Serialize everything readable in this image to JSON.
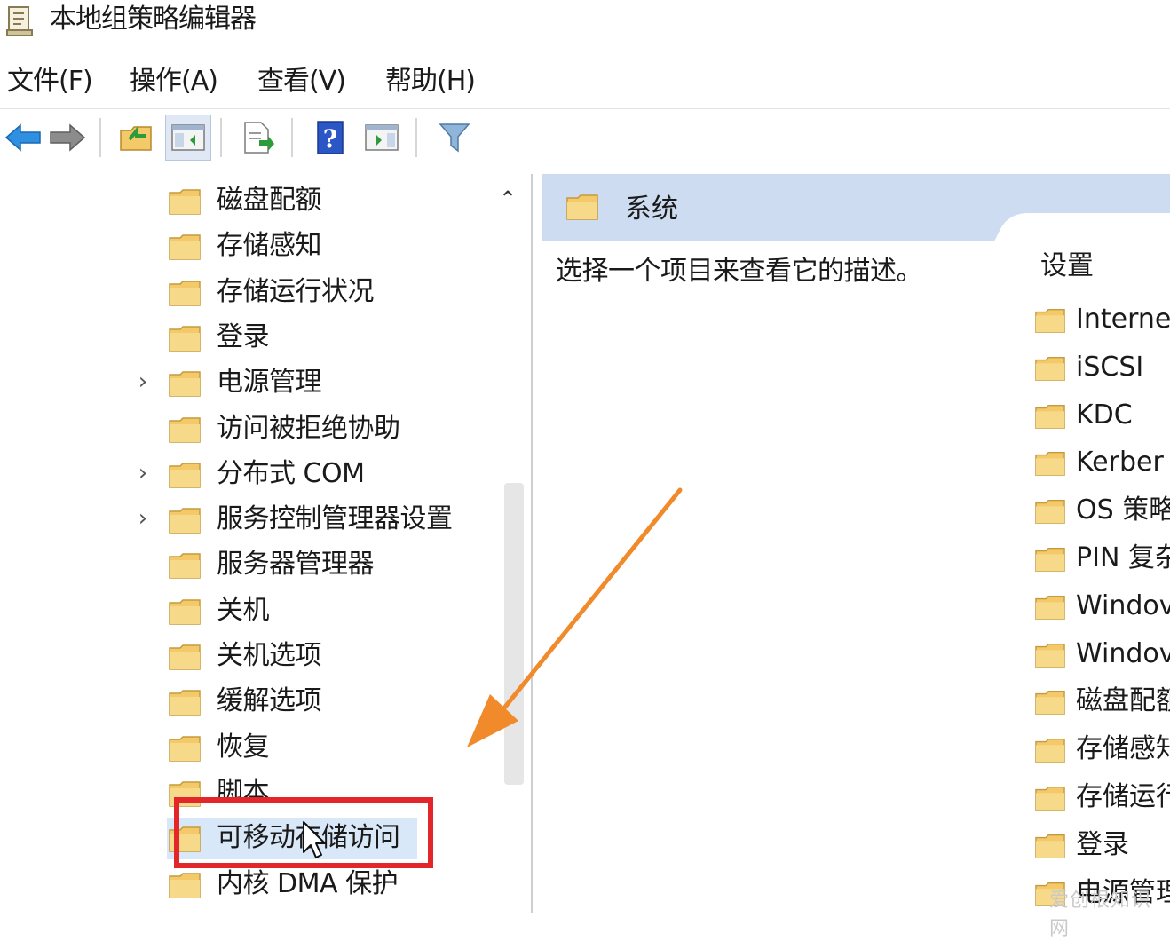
{
  "window": {
    "title": "本地组策略编辑器",
    "icon": "policy-editor-icon"
  },
  "menu": [
    {
      "label": "文件(F)"
    },
    {
      "label": "操作(A)"
    },
    {
      "label": "查看(V)"
    },
    {
      "label": "帮助(H)"
    }
  ],
  "toolbar": {
    "buttons": [
      {
        "name": "back-button",
        "icon": "back-arrow-icon"
      },
      {
        "name": "forward-button",
        "icon": "forward-arrow-icon"
      },
      {
        "name": "up-folder-button",
        "icon": "folder-up-icon"
      },
      {
        "name": "show-hide-tree-button",
        "icon": "console-tree-icon",
        "pressed": true
      },
      {
        "name": "export-list-button",
        "icon": "export-list-icon"
      },
      {
        "name": "help-button",
        "icon": "help-icon"
      },
      {
        "name": "action-pane-button",
        "icon": "action-pane-icon"
      },
      {
        "name": "filter-button",
        "icon": "filter-icon"
      }
    ]
  },
  "tree": {
    "items": [
      {
        "label": "磁盘配额",
        "expandable": false
      },
      {
        "label": "存储感知",
        "expandable": false
      },
      {
        "label": "存储运行状况",
        "expandable": false
      },
      {
        "label": "登录",
        "expandable": false
      },
      {
        "label": "电源管理",
        "expandable": true
      },
      {
        "label": "访问被拒绝协助",
        "expandable": false
      },
      {
        "label": "分布式 COM",
        "expandable": true
      },
      {
        "label": "服务控制管理器设置",
        "expandable": true
      },
      {
        "label": "服务器管理器",
        "expandable": false
      },
      {
        "label": "关机",
        "expandable": false
      },
      {
        "label": "关机选项",
        "expandable": false
      },
      {
        "label": "缓解选项",
        "expandable": false
      },
      {
        "label": "恢复",
        "expandable": false
      },
      {
        "label": "脚本",
        "expandable": false
      },
      {
        "label": "可移动存储访问",
        "expandable": false,
        "selected": true
      },
      {
        "label": "内核 DMA 保护",
        "expandable": false
      }
    ],
    "expander_glyph": "›",
    "scroll_up_glyph": "⌃"
  },
  "details": {
    "header_title": "系统",
    "description": "选择一个项目来查看它的描述。",
    "column_header": "设置",
    "items": [
      {
        "label": "Interne"
      },
      {
        "label": "iSCSI"
      },
      {
        "label": "KDC"
      },
      {
        "label": "Kerber"
      },
      {
        "label": "OS 策略"
      },
      {
        "label": "PIN 复杂"
      },
      {
        "label": "Windov"
      },
      {
        "label": "Windov"
      },
      {
        "label": "磁盘配额"
      },
      {
        "label": "存储感知"
      },
      {
        "label": "存储运行"
      },
      {
        "label": "登录"
      },
      {
        "label": "电源管理"
      }
    ]
  },
  "annotation": {
    "arrow_color": "#f08a2a",
    "highlight_color": "#e3262a"
  },
  "watermark": "爱创根知识网",
  "colors": {
    "folder": "#f3c969",
    "header_blue": "#cddcf0",
    "selection": "#d9e8f8"
  }
}
